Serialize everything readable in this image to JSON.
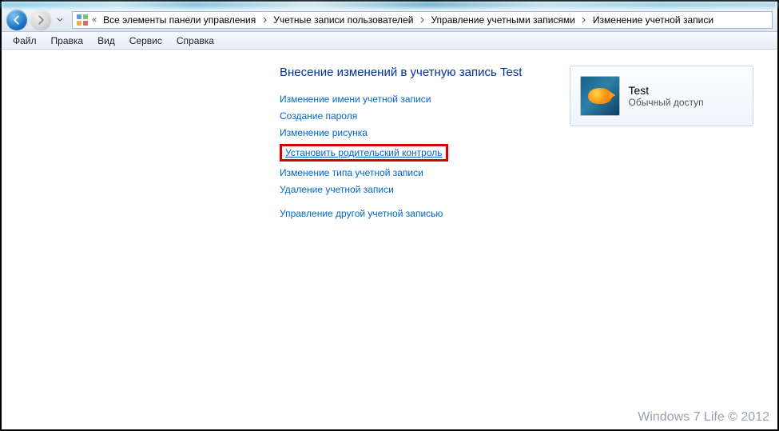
{
  "breadcrumb": {
    "items": [
      "Все элементы панели управления",
      "Учетные записи пользователей",
      "Управление учетными записями",
      "Изменение учетной записи"
    ]
  },
  "menu": {
    "items": [
      "Файл",
      "Правка",
      "Вид",
      "Сервис",
      "Справка"
    ]
  },
  "page": {
    "title": "Внесение изменений в учетную запись Test"
  },
  "tasks": {
    "group1": [
      "Изменение имени учетной записи",
      "Создание пароля",
      "Изменение рисунка",
      "Установить родительский контроль",
      "Изменение типа учетной записи",
      "Удаление учетной записи"
    ],
    "highlighted_index": 3,
    "group2": [
      "Управление другой учетной записью"
    ]
  },
  "user": {
    "name": "Test",
    "role": "Обычный доступ"
  },
  "watermark": "Windows 7 Life © 2012"
}
